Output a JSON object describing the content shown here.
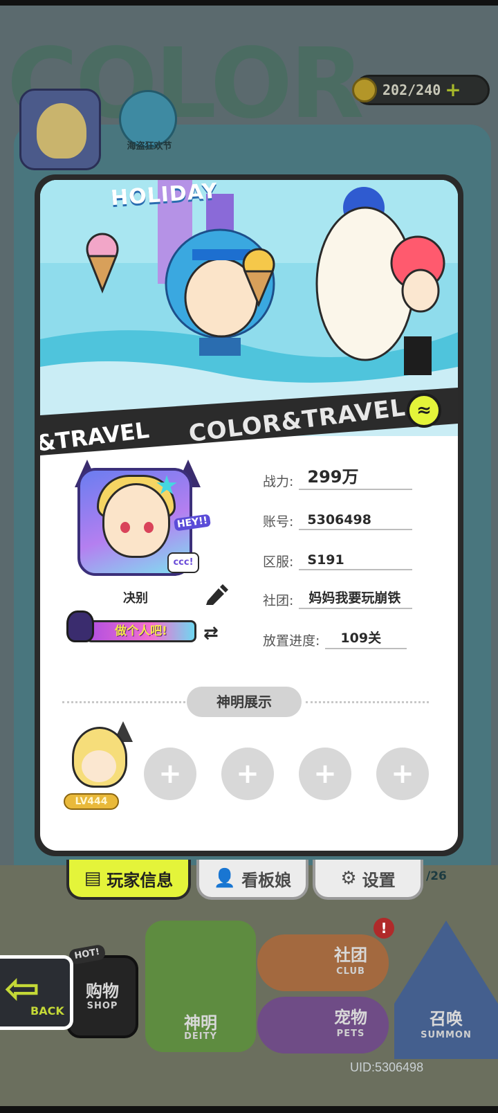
{
  "background": {
    "event_label": "海盗狂欢节",
    "currency": "202/240",
    "page_count": "/26",
    "uid": "UID:5306498",
    "back_label": "BACK",
    "menu": {
      "shop": {
        "label": "购物",
        "sub": "SHOP",
        "badge": "HOT!"
      },
      "deity": {
        "label": "神明",
        "sub": "DEITY"
      },
      "club": {
        "label": "社团",
        "sub": "CLUB",
        "alert": "!"
      },
      "pets": {
        "label": "宠物",
        "sub": "PETS"
      },
      "summon": {
        "label": "召唤",
        "sub": "SUMMON"
      }
    }
  },
  "banner": {
    "holiday_text": "HOLIDAY",
    "strip_text": "COLOR&TRAVEL",
    "strip_text_left": "&TRAVEL"
  },
  "profile": {
    "name": "决别",
    "title_badge": "做个人吧!",
    "avatar_hey": "HEY!!",
    "avatar_tag": "ccc!"
  },
  "info": {
    "power_label": "战力:",
    "power_value": "299万",
    "account_label": "账号:",
    "account_value": "5306498",
    "server_label": "区服:",
    "server_value": "S191",
    "club_label": "社团:",
    "club_value": "妈妈我要玩崩铁",
    "progress_label": "放置进度:",
    "progress_value": "109关"
  },
  "deity_section": {
    "header": "神明展示",
    "level": "LV444",
    "slot_symbol": "+"
  },
  "tabs": {
    "player_info": "玩家信息",
    "mascot": "看板娘",
    "settings": "设置"
  },
  "colors": {
    "accent_yellow": "#e4f43a",
    "frame_dark": "#2a2a2a",
    "card_white": "#ffffff",
    "slot_gray": "#d8d8d8"
  }
}
